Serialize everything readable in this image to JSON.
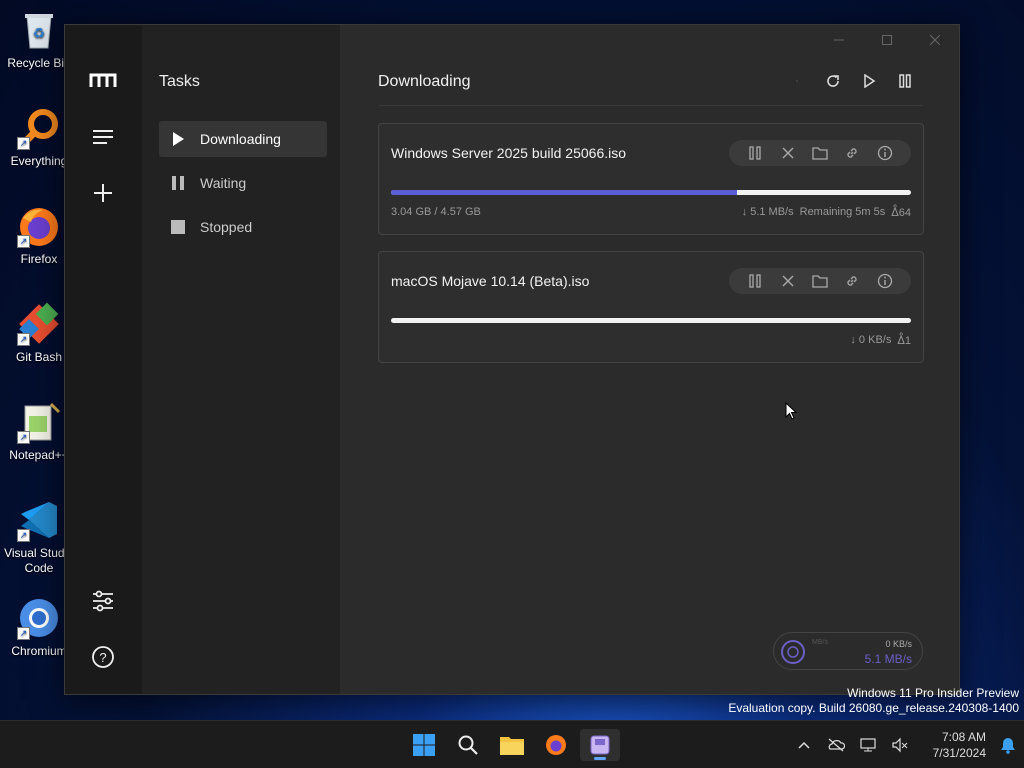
{
  "desktop": {
    "icons": [
      {
        "label": "Recycle Bin"
      },
      {
        "label": "Everything"
      },
      {
        "label": "Firefox"
      },
      {
        "label": "Git Bash"
      },
      {
        "label": "Notepad++"
      },
      {
        "label": "Visual Studio Code"
      },
      {
        "label": "Chromium"
      }
    ],
    "watermark_line1": "Windows 11 Pro Insider Preview",
    "watermark_line2": "Evaluation copy. Build 26080.ge_release.240308-1400"
  },
  "app": {
    "subnav": {
      "title": "Tasks",
      "items": [
        {
          "label": "Downloading",
          "icon": "play-icon",
          "active": true
        },
        {
          "label": "Waiting",
          "icon": "pause-icon",
          "active": false
        },
        {
          "label": "Stopped",
          "icon": "stop-icon",
          "active": false
        }
      ]
    },
    "main": {
      "title": "Downloading",
      "tasks": [
        {
          "name": "Windows Server 2025 build 25066.iso",
          "size": "3.04 GB / 4.57 GB",
          "speed": "↓ 5.1 MB/s",
          "remaining": "Remaining 5m 5s",
          "connections": "64",
          "progress_percent": 66.5
        },
        {
          "name": "macOS Mojave 10.14 (Beta).iso",
          "size": "",
          "speed": "↓ 0 KB/s",
          "remaining": "",
          "connections": "1",
          "progress_percent": 0
        }
      ]
    },
    "speedometer": {
      "mini_label": "MB/s",
      "upload": "0 KB/s",
      "download": "5.1 MB/s"
    }
  },
  "taskbar": {
    "time": "7:08 AM",
    "date": "7/31/2024"
  },
  "colors": {
    "accent": "#5b5fd6",
    "speed_text": "#6b5fc7"
  }
}
